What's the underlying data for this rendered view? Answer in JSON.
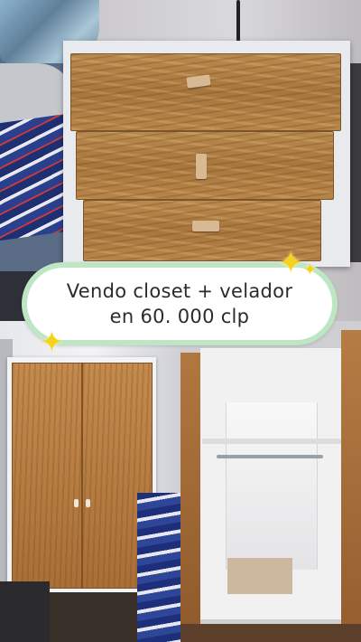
{
  "caption": {
    "line1": "Vendo closet + velador",
    "line2": "en 60. 000 clp"
  },
  "colors": {
    "bubble_border": "#bfe6c4",
    "bubble_fill": "#ffffff",
    "sparkle": "#f6d21c",
    "wood": "#b47a40"
  },
  "icons": {
    "sparkle": "sparkle-icon"
  }
}
